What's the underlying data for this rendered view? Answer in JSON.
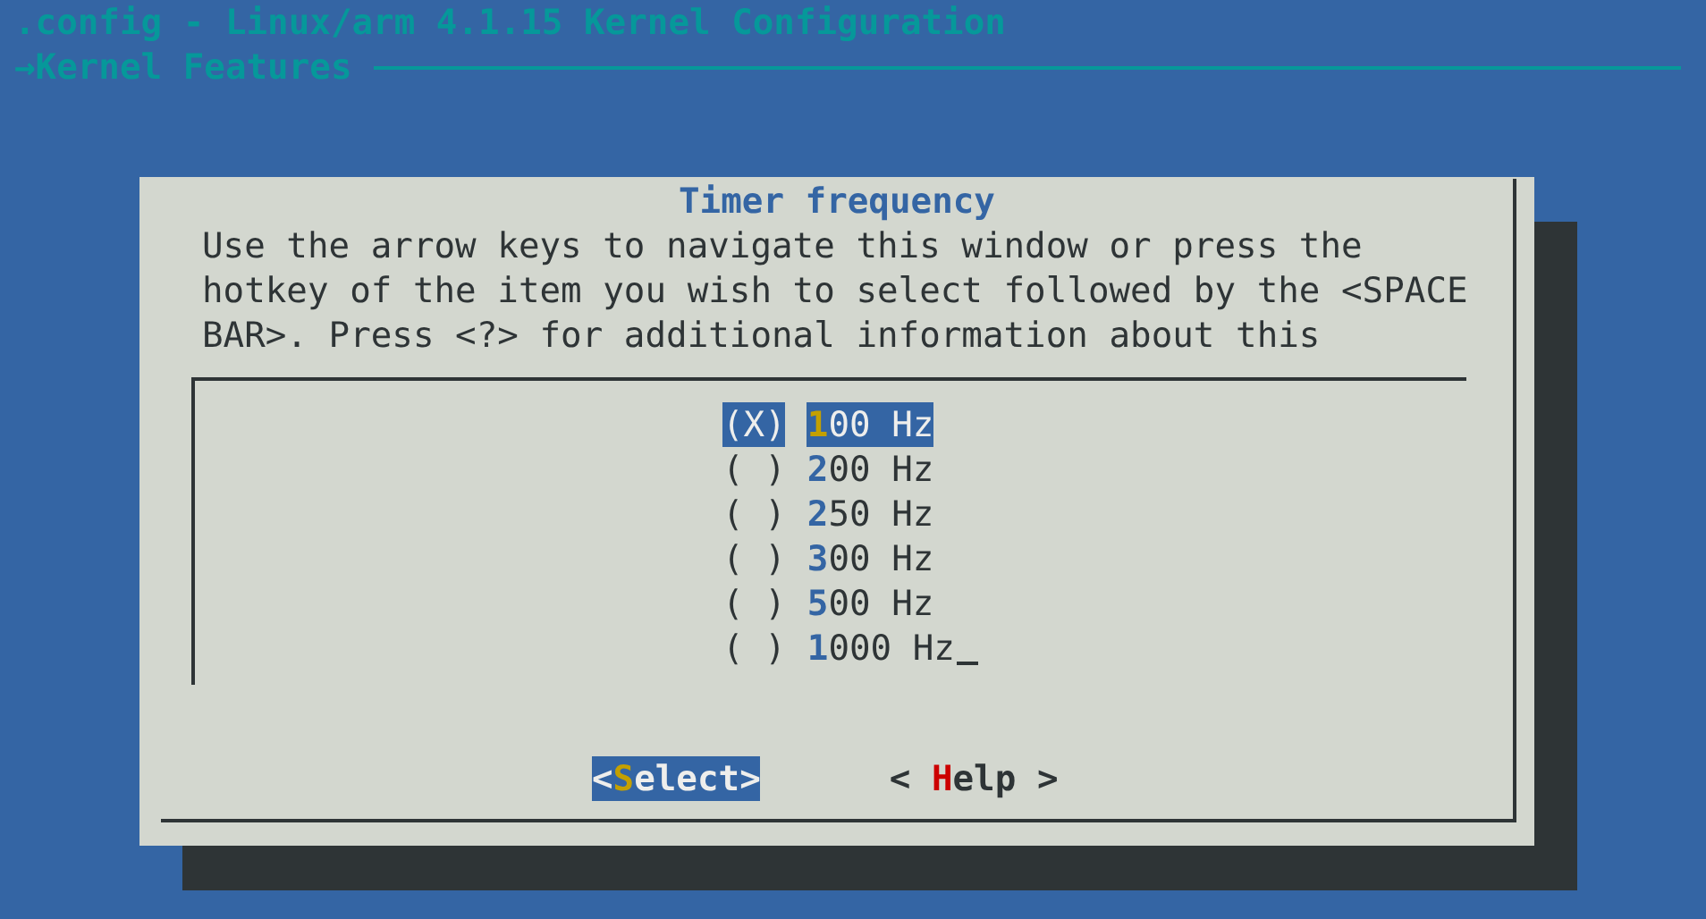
{
  "window": {
    "title": ".config - Linux/arm 4.1.15 Kernel Configuration"
  },
  "breadcrumb": "→Kernel Features",
  "dialog": {
    "title": "Timer frequency",
    "help_text": [
      "Use the arrow keys to navigate this window or press the",
      "hotkey of the item you wish to select followed by the <SPACE",
      "BAR>. Press <?> for additional information about this"
    ],
    "options": [
      {
        "marker": "(X)",
        "label": "100 Hz",
        "selected": true
      },
      {
        "marker": "( )",
        "label": "200 Hz",
        "selected": false
      },
      {
        "marker": "( )",
        "label": "250 Hz",
        "selected": false
      },
      {
        "marker": "( )",
        "label": "300 Hz",
        "selected": false
      },
      {
        "marker": "( )",
        "label": "500 Hz",
        "selected": false
      },
      {
        "marker": "( )",
        "label": "1000 Hz",
        "selected": false
      }
    ],
    "buttons": [
      {
        "label": "<Select>",
        "selected": true
      },
      {
        "label": "< Help >",
        "selected": false
      }
    ]
  }
}
